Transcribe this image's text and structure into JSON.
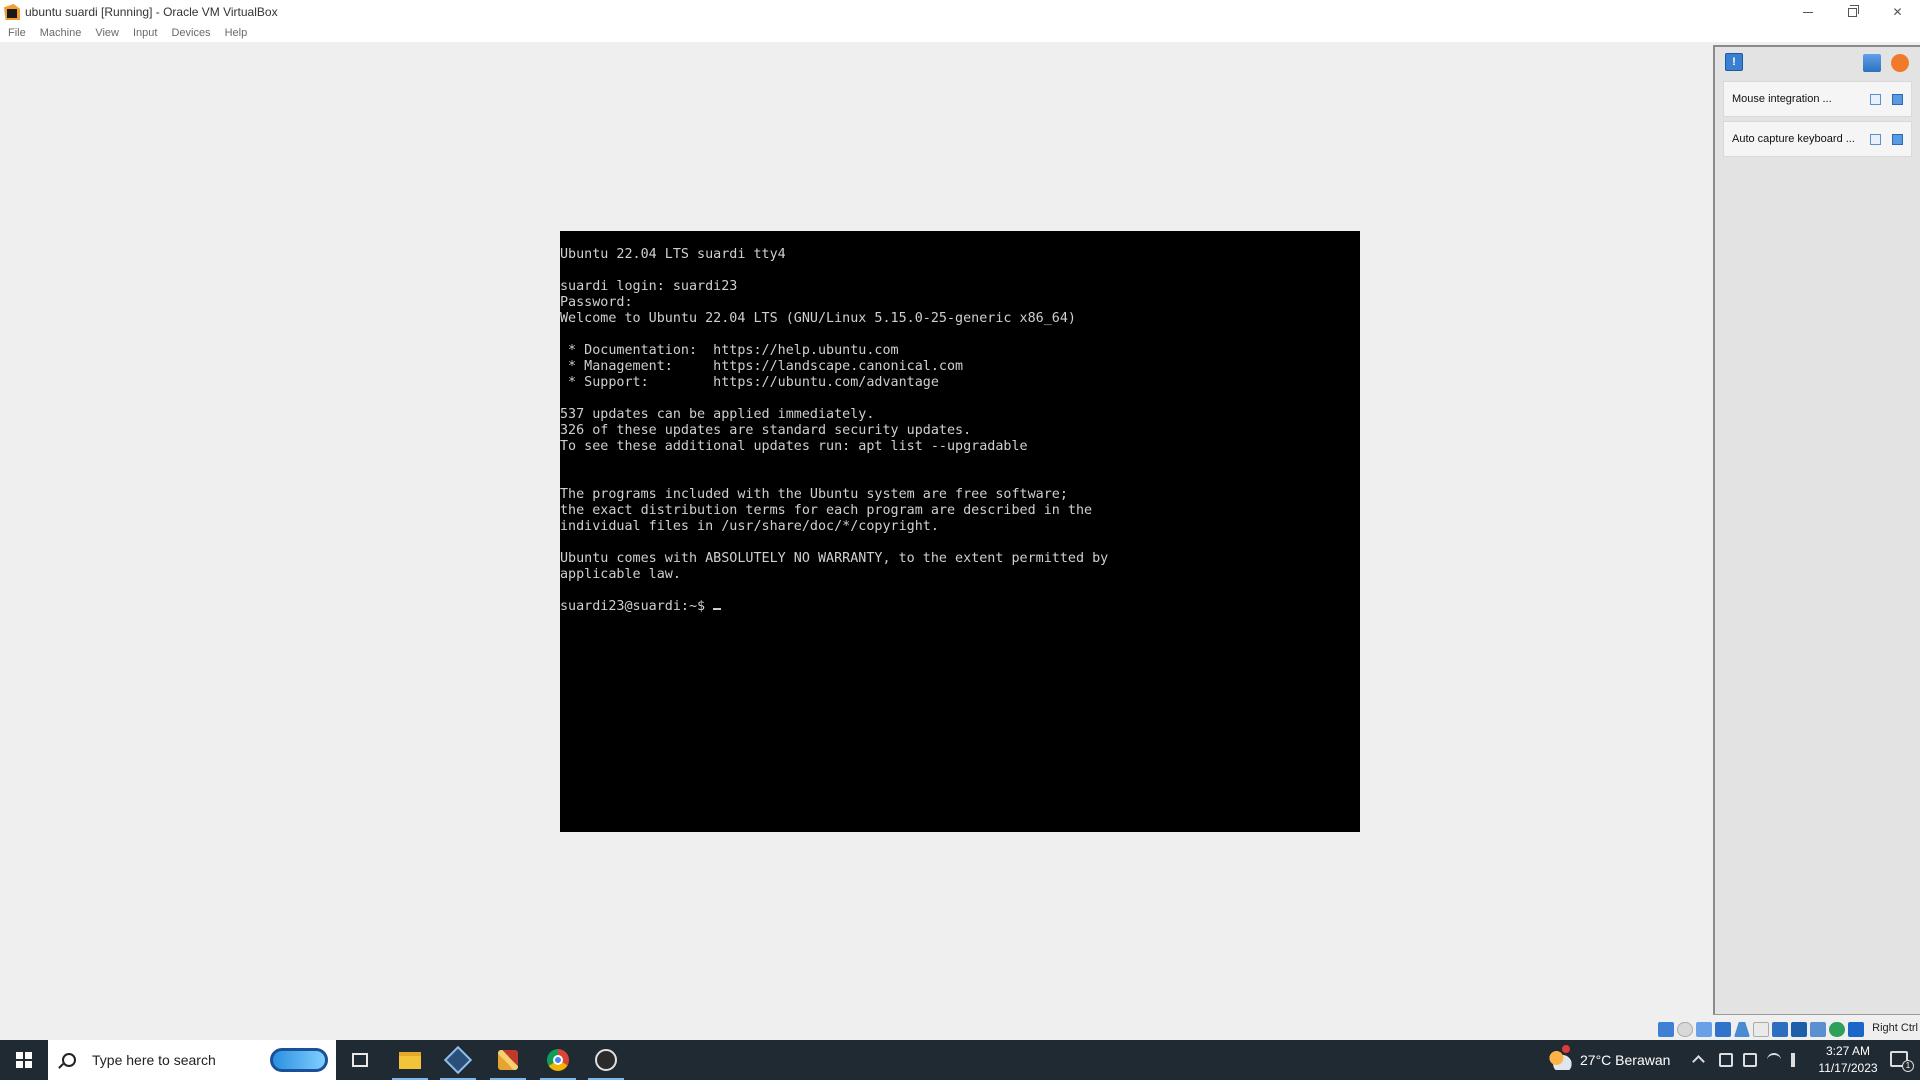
{
  "window": {
    "title": "ubuntu suardi [Running] - Oracle VM VirtualBox"
  },
  "menu": [
    "File",
    "Machine",
    "View",
    "Input",
    "Devices",
    "Help"
  ],
  "terminal": {
    "lines": [
      "Ubuntu 22.04 LTS suardi tty4",
      "",
      "suardi login: suardi23",
      "Password:",
      "Welcome to Ubuntu 22.04 LTS (GNU/Linux 5.15.0-25-generic x86_64)",
      "",
      " * Documentation:  https://help.ubuntu.com",
      " * Management:     https://landscape.canonical.com",
      " * Support:        https://ubuntu.com/advantage",
      "",
      "537 updates can be applied immediately.",
      "326 of these updates are standard security updates.",
      "To see these additional updates run: apt list --upgradable",
      "",
      "",
      "The programs included with the Ubuntu system are free software;",
      "the exact distribution terms for each program are described in the",
      "individual files in /usr/share/doc/*/copyright.",
      "",
      "Ubuntu comes with ABSOLUTELY NO WARRANTY, to the extent permitted by",
      "applicable law.",
      ""
    ],
    "prompt": "suardi23@suardi:~$ "
  },
  "notifications": {
    "items": [
      {
        "text": "Mouse integration ..."
      },
      {
        "text": "Auto capture keyboard ..."
      }
    ]
  },
  "statusbar": {
    "host_key": "Right Ctrl"
  },
  "taskbar": {
    "search_placeholder": "Type here to search",
    "weather": "27°C  Berawan",
    "time": "3:27 AM",
    "date": "11/17/2023",
    "notification_count": "1"
  }
}
